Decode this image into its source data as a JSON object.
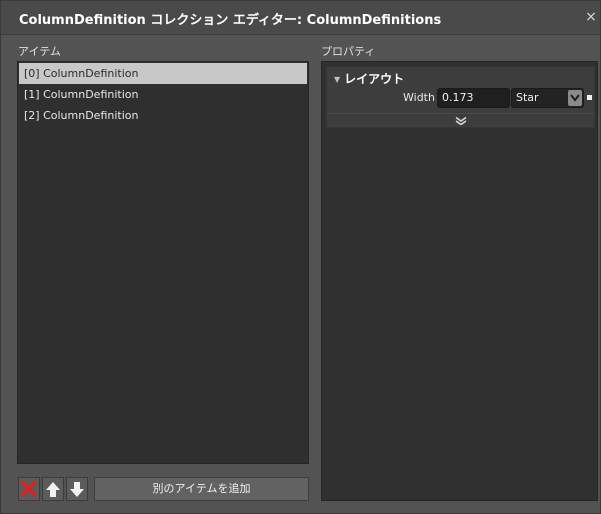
{
  "window": {
    "title": "ColumnDefinition  コレクション エディター: ColumnDefinitions",
    "close_glyph": "×"
  },
  "items_panel": {
    "label": "アイテム",
    "items": [
      {
        "label": "[0] ColumnDefinition",
        "selected": true
      },
      {
        "label": "[1] ColumnDefinition",
        "selected": false
      },
      {
        "label": "[2] ColumnDefinition",
        "selected": false
      }
    ],
    "buttons": {
      "delete_icon": "delete-x-icon",
      "up_icon": "arrow-up-icon",
      "down_icon": "arrow-down-icon",
      "add_label": "別のアイテムを追加"
    }
  },
  "properties_panel": {
    "label": "プロパティ",
    "category": {
      "title": "レイアウト",
      "width_label": "Width",
      "width_value": "0.173",
      "unit_selected": "Star"
    }
  },
  "colors": {
    "delete_red": "#e02020",
    "selection_bg": "#c8c8c8"
  }
}
